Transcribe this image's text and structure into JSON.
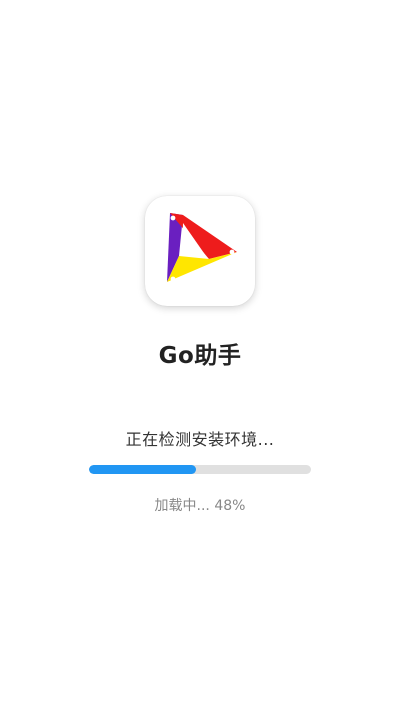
{
  "app": {
    "name": "Go助手",
    "icon": "go-assistant-logo-icon"
  },
  "loader": {
    "status_text": "正在检测安装环境...",
    "progress_label": "加载中... 48%",
    "progress_fraction": 0.48
  },
  "colors": {
    "progress_fill": "#2196f3",
    "progress_track": "#e0e0e0",
    "logo_purple": "#6a1fc0",
    "logo_red": "#ee1c1c",
    "logo_yellow": "#ffe600"
  }
}
